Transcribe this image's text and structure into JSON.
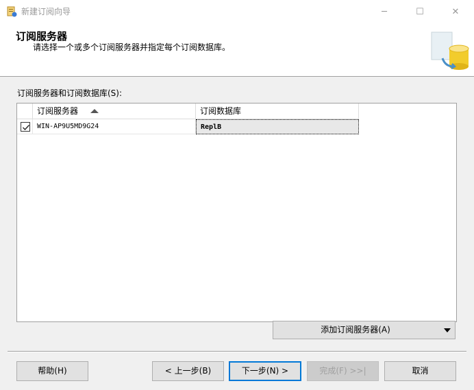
{
  "window": {
    "title": "新建订阅向导",
    "min_glyph": "─",
    "max_glyph": "☐",
    "close_glyph": "✕"
  },
  "header": {
    "title": "订阅服务器",
    "subtitle": "请选择一个或多个订阅服务器并指定每个订阅数据库。"
  },
  "list": {
    "label": "订阅服务器和订阅数据库(S):",
    "columns": [
      "订阅服务器",
      "订阅数据库"
    ],
    "rows": [
      {
        "checked": true,
        "server": "WIN-AP9U5MD9G24",
        "database": "ReplB"
      }
    ]
  },
  "add_button": {
    "label": "添加订阅服务器(A)"
  },
  "buttons": {
    "help": "帮助(H)",
    "back": "< 上一步(B)",
    "next": "下一步(N) >",
    "finish": "完成(F) >>|",
    "cancel": "取消"
  },
  "colors": {
    "accent": "#0078d7",
    "dialog_bg": "#f0f0f0"
  }
}
